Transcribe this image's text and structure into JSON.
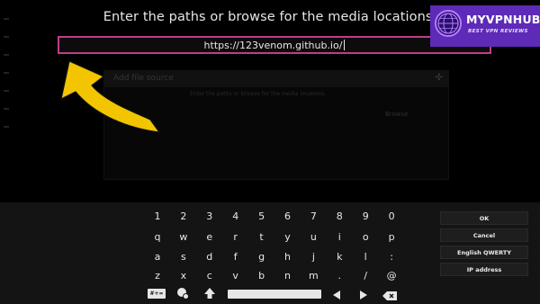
{
  "dialog": {
    "heading": "Enter the paths or browse for the media locations.",
    "input_value": "https://123venom.github.io/"
  },
  "background": {
    "dialog_title": "Add file source",
    "dialog_subtitle": "Enter the paths or browse for the media locations.",
    "browse_label": "Browse"
  },
  "logo": {
    "brand": "MYVPNHUB",
    "tagline": "BEST VPN REVIEWS",
    "accent_color": "#5e2ab8"
  },
  "keyboard": {
    "rows": [
      [
        "1",
        "2",
        "3",
        "4",
        "5",
        "6",
        "7",
        "8",
        "9",
        "0"
      ],
      [
        "q",
        "w",
        "e",
        "r",
        "t",
        "y",
        "u",
        "i",
        "o",
        "p"
      ],
      [
        "a",
        "s",
        "d",
        "f",
        "g",
        "h",
        "j",
        "k",
        "l",
        ":"
      ],
      [
        "z",
        "x",
        "c",
        "v",
        "b",
        "n",
        "m",
        ".",
        "/",
        "@"
      ]
    ],
    "bottom": {
      "symbols_label": "#+=",
      "ip_icon": "globe-ip-icon",
      "shift_icon": "shift-arrow-icon",
      "left_icon": "cursor-left-icon",
      "right_icon": "cursor-right-icon",
      "backspace_icon": "backspace-icon"
    },
    "side_buttons": [
      "OK",
      "Cancel",
      "English QWERTY",
      "IP address"
    ]
  },
  "colors": {
    "input_border": "#c23c88",
    "arrow": "#f2c500"
  }
}
